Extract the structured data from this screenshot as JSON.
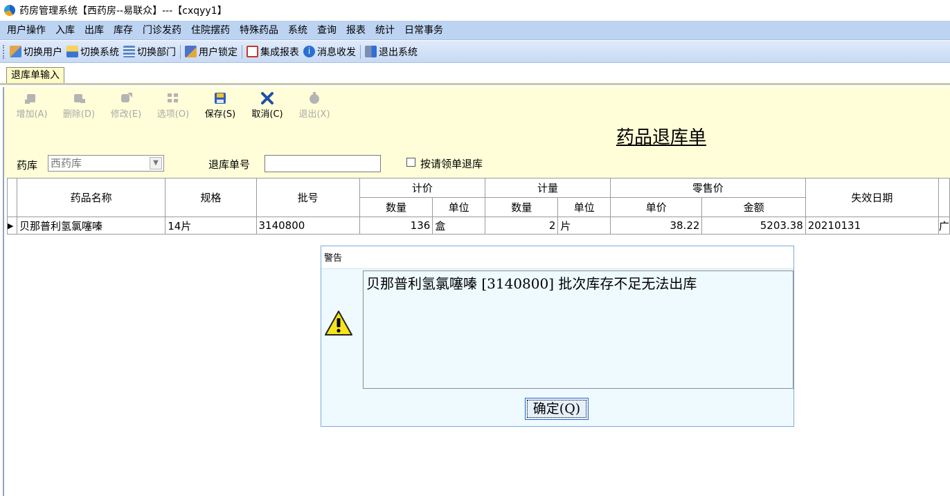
{
  "window": {
    "title": "药房管理系统【西药房--易联众】---【cxqyy1】"
  },
  "menu": [
    "用户操作",
    "入库",
    "出库",
    "库存",
    "门诊发药",
    "住院摆药",
    "特殊药品",
    "系统",
    "查询",
    "报表",
    "统计",
    "日常事务"
  ],
  "toolbar": {
    "switch_user": "切换用户",
    "switch_system": "切换系统",
    "switch_dept": "切换部门",
    "user_lock": "用户锁定",
    "report": "集成报表",
    "message": "消息收发",
    "exit": "退出系统"
  },
  "tab": {
    "label": "退库单输入"
  },
  "actions": {
    "add": "增加(A)",
    "delete": "删除(D)",
    "edit": "修改(E)",
    "options": "选项(O)",
    "save": "保存(S)",
    "cancel": "取消(C)",
    "exit": "退出(X)"
  },
  "form": {
    "doc_title": "药品退库单",
    "pharmacy_label": "药库",
    "pharmacy_value": "西药库",
    "order_no_label": "退库单号",
    "order_no_value": "",
    "by_request_label": "按请领单退库"
  },
  "grid": {
    "headers": {
      "name": "药品名称",
      "spec": "规格",
      "batch": "批号",
      "pricing": "计价",
      "measure": "计量",
      "retail": "零售价",
      "expiry": "失效日期",
      "qty": "数量",
      "unit": "单位",
      "unit_price": "单价",
      "amount": "金额"
    },
    "rows": [
      {
        "marker": "▶",
        "name": "贝那普利氢氯噻嗪",
        "spec": "14片",
        "batch": "3140800",
        "price_qty": "136",
        "price_unit": "盒",
        "measure_qty": "2",
        "measure_unit": "片",
        "unit_price": "38.22",
        "amount": "5203.38",
        "expiry": "20210131",
        "extra": "广"
      }
    ]
  },
  "dialog": {
    "title": "警告",
    "message": "贝那普利氢氯噻嗪 [3140800] 批次库存不足无法出库",
    "ok": "确定(Q)"
  }
}
